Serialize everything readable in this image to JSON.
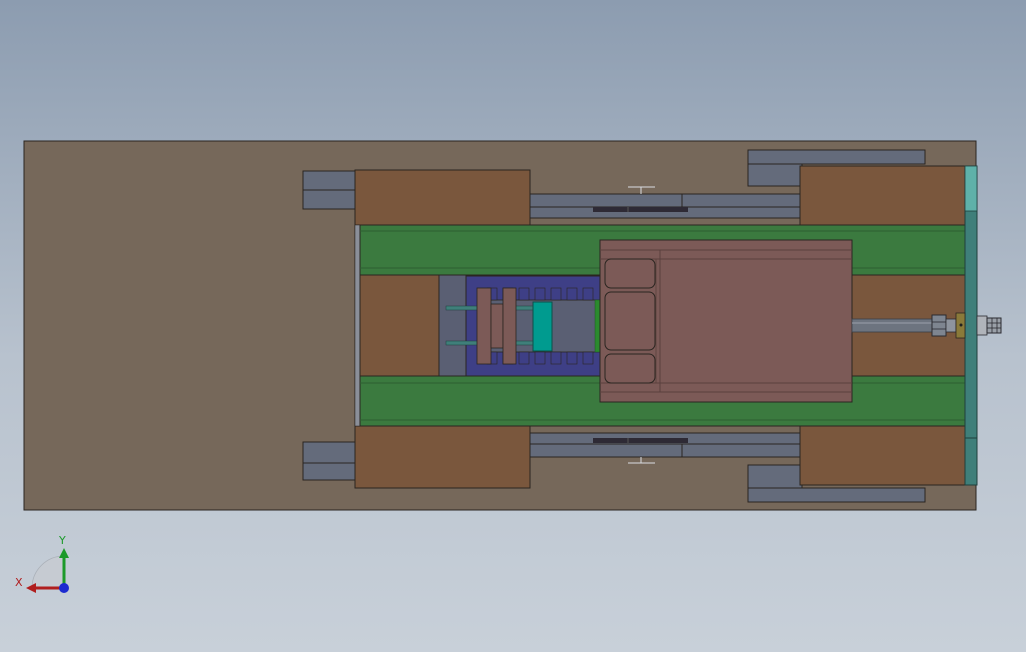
{
  "colors": {
    "base_plate": "#76685a",
    "block_brown": "#7a573d",
    "rail_green": "#3b7a3f",
    "rail_edge": "#2e5f31",
    "carriage": "#7c5a57",
    "carriage_edge": "#5a403d",
    "slate_blue": "#3e3f86",
    "gray_steel": "#646b7b",
    "teal": "#009b8f",
    "teal_plate": "#3f7f7a",
    "teal_light": "#5fb1a9",
    "outline": "#2a2520",
    "axis_x": "#b01e1e",
    "axis_y": "#1c9a2a",
    "axis_z": "#1c2bd0"
  },
  "triad": {
    "x_label": "X",
    "y_label": "Y",
    "x_icon": "x-axis-arrow-icon",
    "y_icon": "y-axis-arrow-icon",
    "z_icon": "z-axis-dot-icon"
  }
}
